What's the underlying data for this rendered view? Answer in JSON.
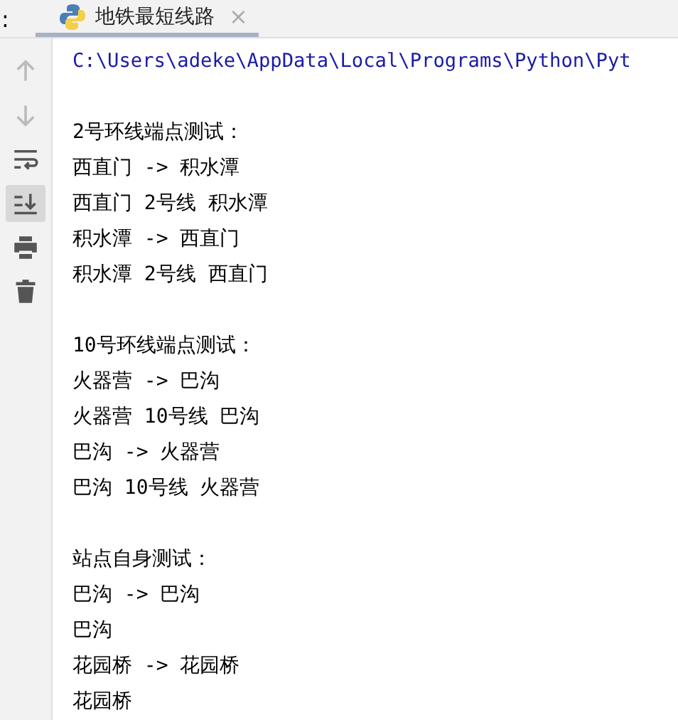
{
  "tab_strip": {
    "edge_label": ":",
    "tabs": [
      {
        "label": "地铁最短线路",
        "close": "×",
        "selected": true
      }
    ]
  },
  "toolbar": [
    {
      "kind": "up",
      "disabled": true,
      "selected": false
    },
    {
      "kind": "down",
      "disabled": true,
      "selected": false
    },
    {
      "kind": "wrap",
      "disabled": false,
      "selected": false
    },
    {
      "kind": "scroll-end",
      "disabled": false,
      "selected": true
    },
    {
      "kind": "print",
      "disabled": false,
      "selected": false
    },
    {
      "kind": "trash",
      "disabled": false,
      "selected": false
    }
  ],
  "console": {
    "command": "C:\\Users\\adeke\\AppData\\Local\\Programs\\Python\\Pyt",
    "blocks": [
      {
        "lines": [
          "2号环线端点测试：",
          "西直门 -> 积水潭",
          "西直门 2号线 积水潭",
          "积水潭 -> 西直门",
          "积水潭 2号线 西直门"
        ]
      },
      {
        "lines": [
          "10号环线端点测试：",
          "火器营 -> 巴沟",
          "火器营 10号线 巴沟",
          "巴沟 -> 火器营",
          "巴沟 10号线 火器营"
        ]
      },
      {
        "lines": [
          "站点自身测试：",
          "巴沟 -> 巴沟",
          "巴沟",
          "花园桥 -> 花园桥",
          "花园桥"
        ]
      }
    ]
  }
}
